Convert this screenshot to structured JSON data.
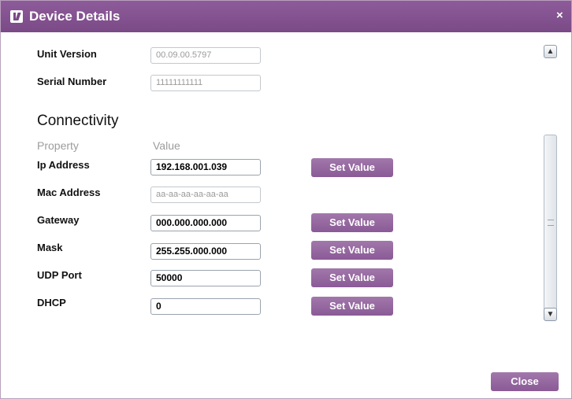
{
  "window": {
    "title": "Device Details",
    "close_glyph": "×"
  },
  "device": {
    "unit_version_label": "Unit Version",
    "unit_version_value": "00.09.00.5797",
    "serial_number_label": "Serial Number",
    "serial_number_value": "11111111111"
  },
  "connectivity": {
    "heading": "Connectivity",
    "col_property": "Property",
    "col_value": "Value",
    "rows": [
      {
        "label": "Ip Address",
        "value": "192.168.001.039",
        "button": "Set Value"
      },
      {
        "label": "Mac Address",
        "value": "aa-aa-aa-aa-aa-aa"
      },
      {
        "label": "Gateway",
        "value": "000.000.000.000",
        "button": "Set Value"
      },
      {
        "label": "Mask",
        "value": "255.255.000.000",
        "button": "Set Value"
      },
      {
        "label": "UDP Port",
        "value": "50000",
        "button": "Set Value"
      },
      {
        "label": "DHCP",
        "value": "0",
        "button": "Set Value"
      }
    ]
  },
  "footer": {
    "close_label": "Close"
  },
  "colors": {
    "accent": "#8a5a96",
    "title_bar": "#7a4a87"
  },
  "icons": {
    "app": "kramer-logo-icon",
    "scroll_up": "scroll-up-icon",
    "scroll_down": "scroll-down-icon"
  }
}
